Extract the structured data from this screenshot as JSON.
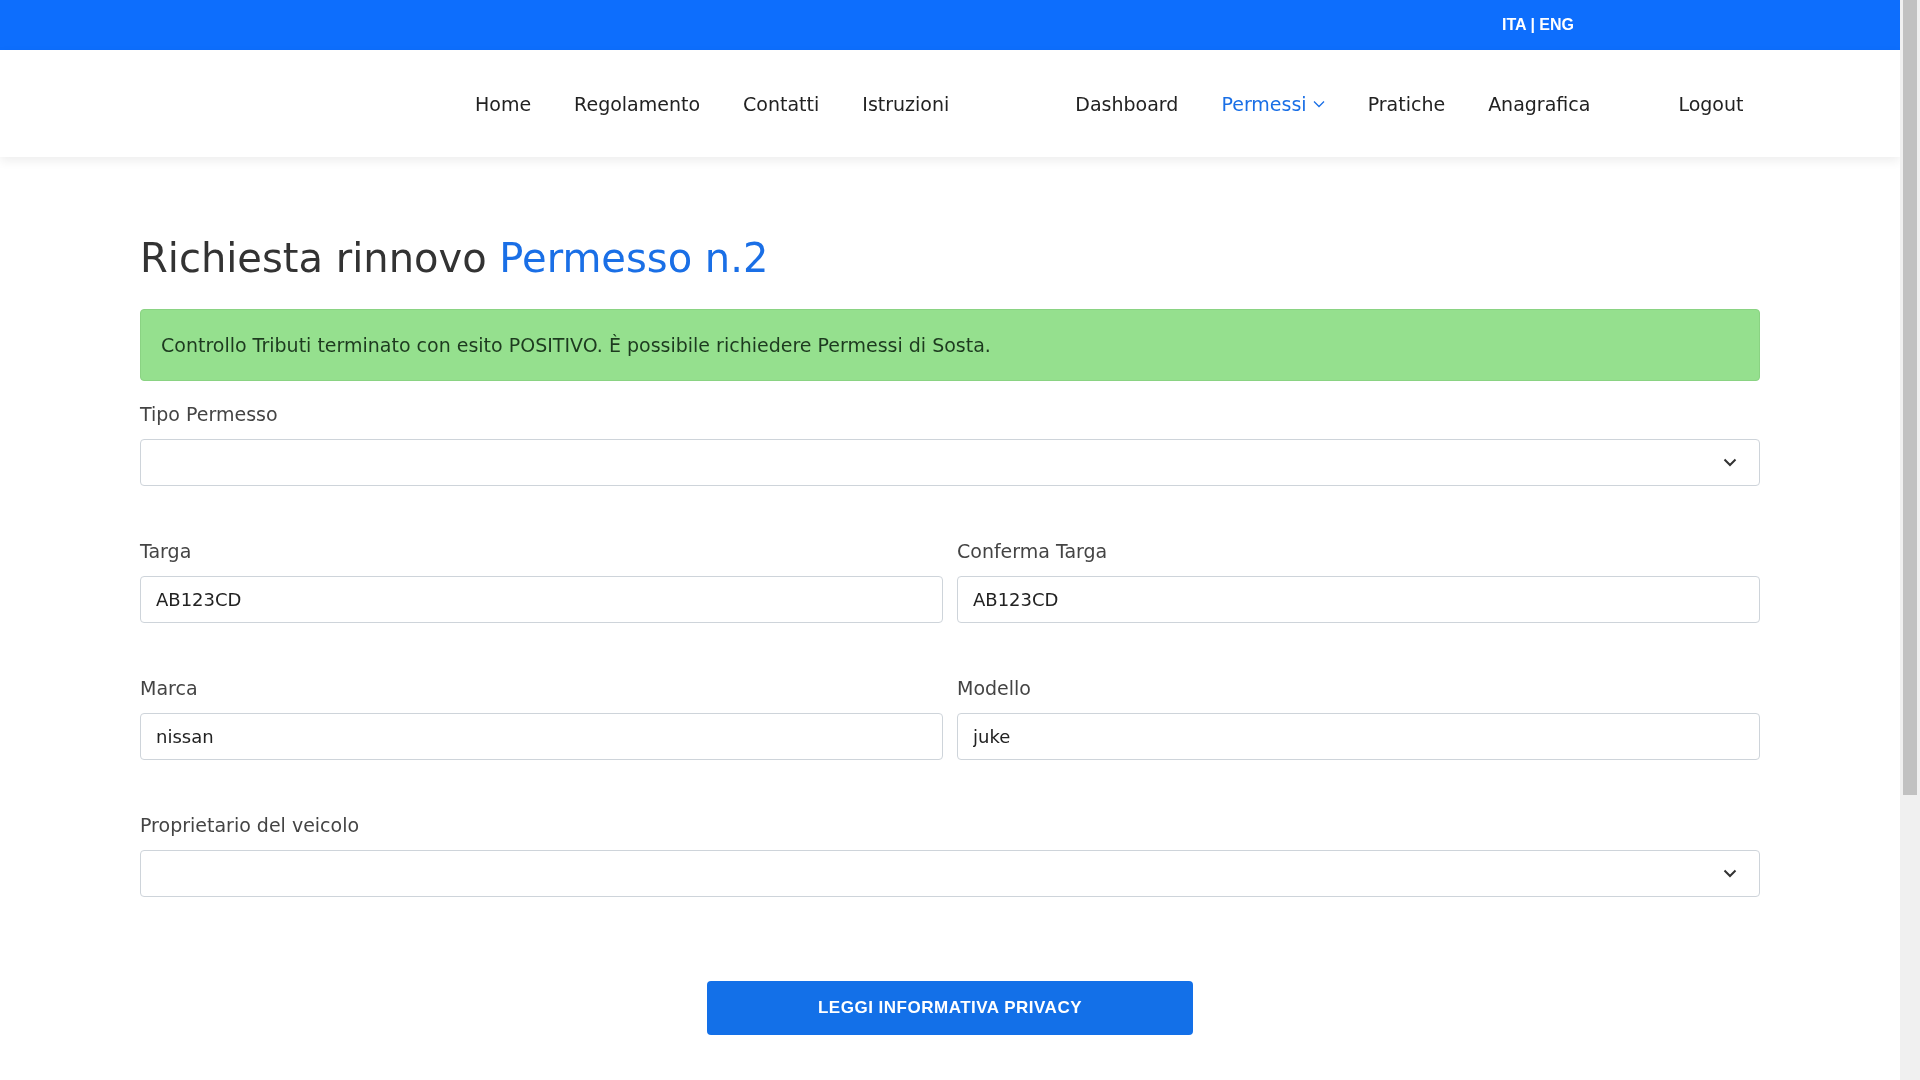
{
  "top_bar": {
    "language": "ITA | ENG"
  },
  "nav": {
    "groups": [
      [
        {
          "label": "Home",
          "selected": false
        },
        {
          "label": "Regolamento",
          "selected": false
        },
        {
          "label": "Contatti",
          "selected": false
        },
        {
          "label": "Istruzioni",
          "selected": false
        }
      ],
      [
        {
          "label": "Dashboard",
          "selected": false
        },
        {
          "label": "Permessi",
          "selected": true,
          "dropdown": true
        },
        {
          "label": "Pratiche",
          "selected": false
        },
        {
          "label": "Anagrafica",
          "selected": false
        }
      ],
      [
        {
          "label": "Logout",
          "selected": false
        }
      ]
    ]
  },
  "title": {
    "text": "Richiesta rinnovo",
    "highlight": "Permesso n.2"
  },
  "alert": {
    "message": "Controllo Tributi terminato con esito POSITIVO. È possibile richiedere Permessi di Sosta."
  },
  "form": {
    "rows": [
      [
        {
          "kind": "select",
          "label": "Tipo Permesso"
        }
      ],
      [
        {
          "kind": "text",
          "label": "Targa",
          "value": "AB123CD"
        },
        {
          "kind": "text",
          "label": "Conferma Targa",
          "value": "AB123CD"
        }
      ],
      [
        {
          "kind": "text",
          "label": "Marca",
          "value": "nissan"
        },
        {
          "kind": "text",
          "label": "Modello",
          "value": "juke"
        }
      ],
      [
        {
          "kind": "select",
          "label": "Proprietario del veicolo"
        }
      ]
    ]
  },
  "privacy_button": {
    "label": "LEGGI INFORMATIVA PRIVACY"
  }
}
